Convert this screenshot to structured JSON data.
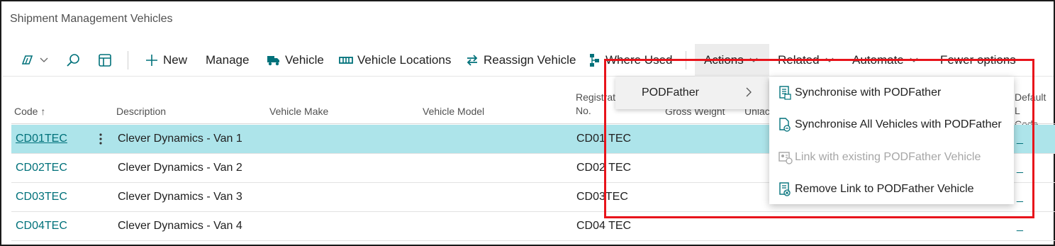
{
  "page": {
    "title": "Shipment Management Vehicles"
  },
  "toolbar": {
    "new_label": "New",
    "manage_label": "Manage",
    "vehicle_label": "Vehicle",
    "vehicle_locations_label": "Vehicle Locations",
    "reassign_vehicle_label": "Reassign Vehicle",
    "where_used_label": "Where Used",
    "actions_label": "Actions",
    "related_label": "Related",
    "automate_label": "Automate",
    "fewer_options_label": "Fewer options"
  },
  "columns": {
    "code": "Code",
    "code_sort_glyph": "↑",
    "description": "Description",
    "vehicle_make": "Vehicle Make",
    "vehicle_model": "Vehicle Model",
    "registration_line1": "Registrat",
    "registration_line2": "No.",
    "gross_weight": "Gross Weight",
    "unladen": "Unlac",
    "default_line1": "Default L",
    "default_line2": "Code"
  },
  "rows": [
    {
      "code": "CD01TEC",
      "description": "Clever Dynamics - Van 1",
      "registration": "CD01 TEC",
      "default_code": "_"
    },
    {
      "code": "CD02TEC",
      "description": "Clever Dynamics - Van 2",
      "registration": "CD02 TEC",
      "default_code": "_"
    },
    {
      "code": "CD03TEC",
      "description": "Clever Dynamics - Van 3",
      "registration": "CD03TEC",
      "default_code": "_"
    },
    {
      "code": "CD04TEC",
      "description": "Clever Dynamics - Van 4",
      "registration": "CD04 TEC",
      "default_code": "_"
    }
  ],
  "actions_menu": {
    "submenu_label": "PODFather",
    "items": [
      {
        "label": "Synchronise with PODFather",
        "enabled": true
      },
      {
        "label": "Synchronise All Vehicles with PODFather",
        "enabled": true
      },
      {
        "label": "Link with existing PODFather Vehicle",
        "enabled": false
      },
      {
        "label": "Remove Link to PODFather Vehicle",
        "enabled": true
      }
    ]
  },
  "colors": {
    "accent": "#00717a",
    "selected_row": "#ade4ea",
    "highlight_box": "#e8141b"
  },
  "icons": {
    "views": "views-icon",
    "search": "search-icon",
    "layout": "layout-icon",
    "new": "plus-icon",
    "vehicle": "truck-icon",
    "vehicle_locations": "rail-icon",
    "reassign": "swap-arrows-icon",
    "where_used": "hierarchy-icon"
  }
}
